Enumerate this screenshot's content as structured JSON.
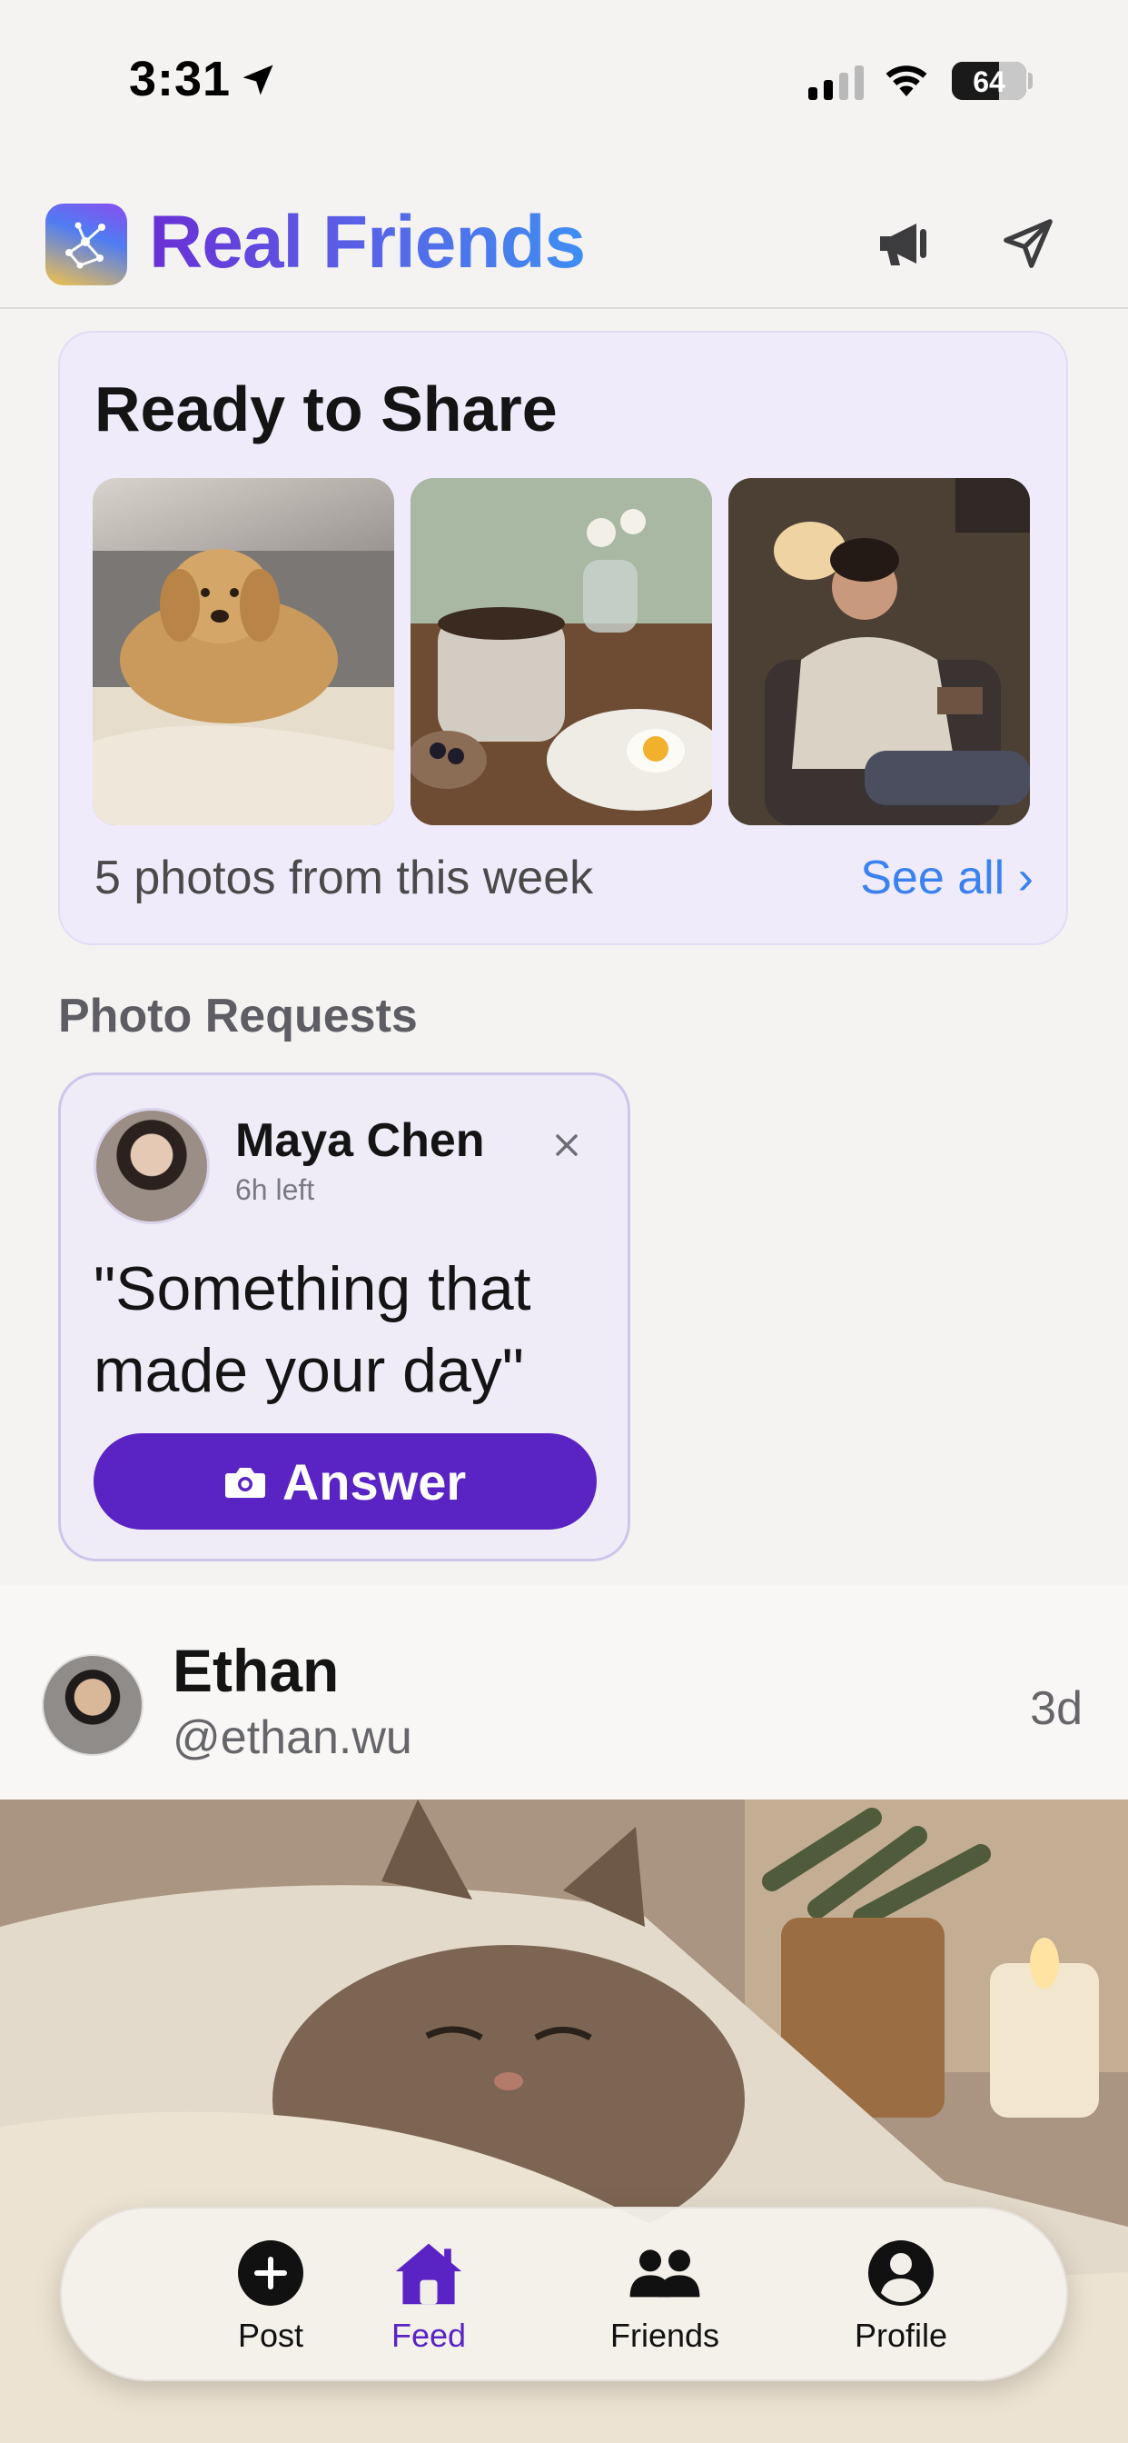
{
  "status_bar": {
    "time": "3:31",
    "battery": "64",
    "battery_level": 0.64,
    "signal_bars_active": 2,
    "signal_bars_total": 4
  },
  "header": {
    "title": "Real Friends",
    "icons": [
      "app-logo",
      "megaphone-icon",
      "send-icon"
    ]
  },
  "ready_to_share": {
    "title": "Ready to Share",
    "photos": [
      "golden-retriever-on-couch-photo",
      "coffee-and-breakfast-photo",
      "woman-reading-in-chair-photo"
    ],
    "count_text": "5 photos from this week",
    "see_all": "See all ›"
  },
  "photo_requests": {
    "heading": "Photo Requests",
    "items": [
      {
        "name": "Maya Chen",
        "time_left": "6h left",
        "prompt": "\"Something that made your day\"",
        "answer_label": "Answer"
      }
    ]
  },
  "post": {
    "name": "Ethan",
    "handle": "@ethan.wu",
    "age": "3d",
    "image": "sleeping-tabby-cat-under-blanket-photo"
  },
  "tab_bar": {
    "tabs": [
      {
        "label": "Post",
        "icon": "plus-circle-icon"
      },
      {
        "label": "Feed",
        "icon": "home-icon",
        "active": true
      },
      {
        "label": "Friends",
        "icon": "people-icon"
      },
      {
        "label": "Profile",
        "icon": "person-circle-icon"
      }
    ]
  },
  "colors": {
    "accent": "#5a24c4",
    "link": "#3a82f0",
    "card_bg": "#efebfb"
  }
}
